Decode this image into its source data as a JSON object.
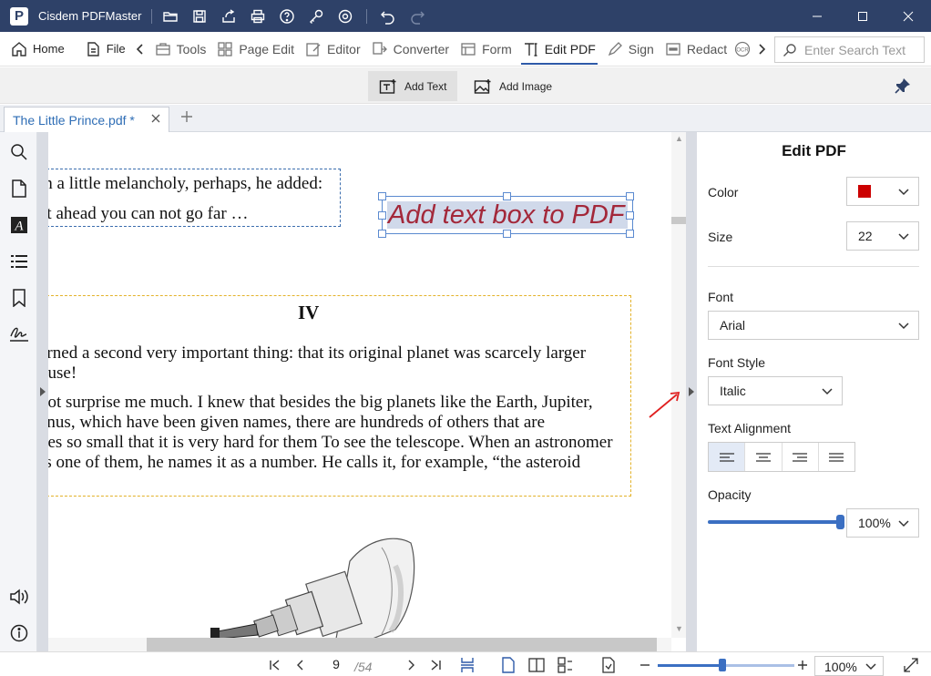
{
  "app": {
    "title": "Cisdem PDFMaster",
    "logo_letter": "P"
  },
  "menubar": {
    "home": "Home",
    "file": "File",
    "tools": "Tools",
    "page_edit": "Page Edit",
    "editor": "Editor",
    "converter": "Converter",
    "form": "Form",
    "edit_pdf": "Edit PDF",
    "sign": "Sign",
    "redact": "Redact",
    "ocr": "OCR",
    "search_placeholder": "Enter Search Text"
  },
  "subbar": {
    "add_text": "Add Text",
    "add_image": "Add Image"
  },
  "tabs": [
    {
      "label": "The Little Prince.pdf *"
    }
  ],
  "document": {
    "lines_top": [
      "th a little melancholy, perhaps, he added:",
      "at ahead you can not go far …"
    ],
    "heading": "IV",
    "para1": [
      "arned a second very important thing: that its original planet was scarcely larger",
      "ouse!"
    ],
    "para2": [
      "not surprise me much. I knew that besides the big planets like the Earth, Jupiter,",
      "enus, which have been given names, there are hundreds of others that are",
      "nes so small that it is very hard for them To see the telescope. When an astronomer",
      "rs one of them, he names it as a number. He calls it, for example, “the asteroid"
    ],
    "new_text_box": "Add text box to PDF",
    "new_text_color": "#a3283a"
  },
  "panel": {
    "title": "Edit PDF",
    "color_label": "Color",
    "color_value": "#cc0000",
    "size_label": "Size",
    "size_value": "22",
    "font_label": "Font",
    "font_value": "Arial",
    "font_style_label": "Font Style",
    "font_style_value": "Italic",
    "text_alignment_label": "Text Alignment",
    "alignment_selected": "left",
    "opacity_label": "Opacity",
    "opacity_value": "100%",
    "opacity_fraction": 1.0
  },
  "status": {
    "current_page": "9",
    "total_pages": "/54",
    "zoom": "100%",
    "zoom_fraction": 0.47
  },
  "colors": {
    "titlebar": "#2e4168",
    "accent": "#3b6fc2"
  }
}
